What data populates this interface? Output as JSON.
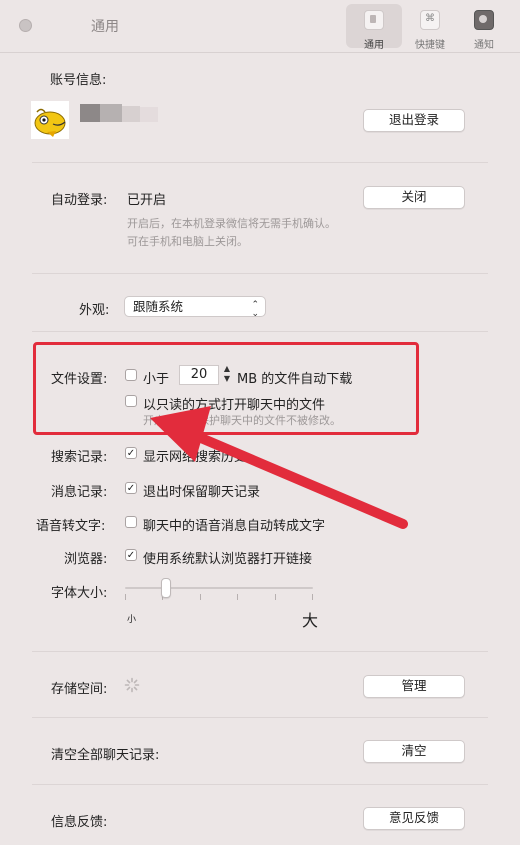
{
  "window": {
    "title": "通用"
  },
  "toolbar": [
    {
      "label": "通用",
      "icon": "general-icon"
    },
    {
      "label": "快捷键",
      "icon": "shortcut-icon"
    },
    {
      "label": "通知",
      "icon": "notification-icon"
    }
  ],
  "account": {
    "label": "账号信息:",
    "logout": "退出登录"
  },
  "autologin": {
    "label": "自动登录:",
    "status": "已开启",
    "button": "关闭",
    "hint1": "开启后，在本机登录微信将无需手机确认。",
    "hint2": "可在手机和电脑上关闭。"
  },
  "appearance": {
    "label": "外观:",
    "value": "跟随系统"
  },
  "files": {
    "label": "文件设置:",
    "opt1_pre": "小于",
    "opt1_value": "20",
    "opt1_post": "MB 的文件自动下载",
    "opt2": "以只读的方式打开聊天中的文件",
    "hint": "开启后，可保护聊天中的文件不被修改。"
  },
  "search": {
    "label": "搜索记录:",
    "opt": "显示网络搜索历史"
  },
  "messages": {
    "label": "消息记录:",
    "opt": "退出时保留聊天记录"
  },
  "voice": {
    "label": "语音转文字:",
    "opt": "聊天中的语音消息自动转成文字"
  },
  "browser": {
    "label": "浏览器:",
    "opt": "使用系统默认浏览器打开链接"
  },
  "font": {
    "label": "字体大小:",
    "small": "小",
    "large": "大",
    "level": 0.22
  },
  "storage": {
    "label": "存储空间:",
    "button": "管理"
  },
  "clear": {
    "label": "清空全部聊天记录:",
    "button": "清空"
  },
  "feedback": {
    "label": "信息反馈:",
    "button": "意见反馈"
  },
  "colors": {
    "annotation": "#e22c3c",
    "background": "#ece6e6"
  }
}
